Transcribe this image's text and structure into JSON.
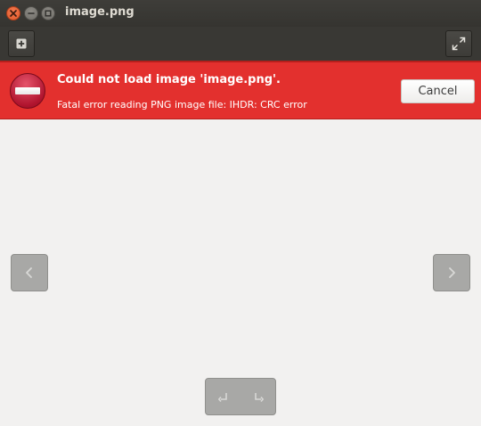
{
  "window": {
    "title": "image.png"
  },
  "icons": {
    "close": "close-icon",
    "minimize": "minimize-icon",
    "maximize": "maximize-icon",
    "new_window": "plus-box-icon",
    "fullscreen": "fullscreen-icon",
    "error": "error-no-entry-icon",
    "previous": "chevron-left-icon",
    "next": "chevron-right-icon",
    "rotate_left": "rotate-left-icon",
    "rotate_right": "rotate-right-icon"
  },
  "infobar": {
    "title": "Could not load image 'image.png'.",
    "detail": "Fatal error reading PNG image file: IHDR: CRC error",
    "cancel_label": "Cancel"
  },
  "colors": {
    "titlebar": "#3e3d39",
    "headerbar": "#393834",
    "error_background": "#e3302e",
    "canvas": "#f2f1f0",
    "close_button": "#e95420"
  }
}
